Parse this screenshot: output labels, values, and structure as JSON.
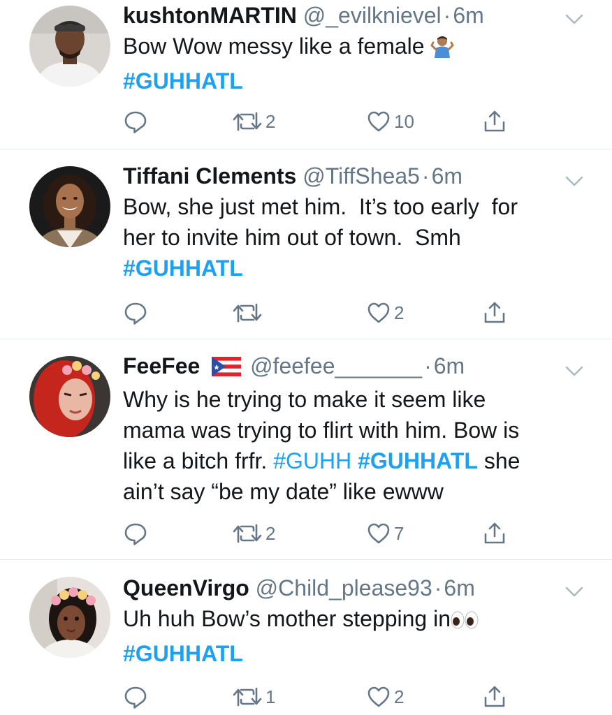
{
  "tweets": [
    {
      "name": "kushtonMARTIN",
      "handle": "@_evilknievel",
      "dot": "·",
      "time": "6m",
      "text_lines": [
        "Bow Wow messy like a female"
      ],
      "hashtag": "#GUHHATL",
      "retweets": "2",
      "likes": "10",
      "avatar_icon": "man-avatar",
      "emoji_icon": "person-shrugging-icon"
    },
    {
      "name": "Tiffani Clements",
      "handle": "@TiffShea5",
      "dot": "·",
      "time": "6m",
      "text_lines": [
        "Bow, she just met him.  It’s too early  for",
        "her to invite him out of town.  Smh"
      ],
      "hashtag": "#GUHHATL",
      "retweets": "",
      "likes": "2",
      "avatar_icon": "woman-avatar"
    },
    {
      "name": "FeeFee",
      "handle": "@feefee_______",
      "dot": "·",
      "time": "6m",
      "text_lines": [
        "Why is he trying to make it seem like",
        "mama was trying to flirt with him. Bow is",
        "like a bitch frfr."
      ],
      "inline_hashtag_1": "#GUHH",
      "inline_hashtag_2": "#GUHHATL",
      "text_after_line3": "she",
      "text_line4": "ain’t say “be my date” like ewww",
      "retweets": "2",
      "likes": "7",
      "avatar_icon": "red-hair-woman-avatar",
      "flag_icon": "puerto-rico-flag-icon"
    },
    {
      "name": "QueenVirgo",
      "handle": "@Child_please93",
      "dot": "·",
      "time": "6m",
      "text_lines": [
        "Uh huh Bow’s mother stepping in"
      ],
      "hashtag": "#GUHHATL",
      "retweets": "1",
      "likes": "2",
      "avatar_icon": "flower-crown-woman-avatar",
      "emoji_icon": "eyes-icon"
    }
  ],
  "colors": {
    "text": "#14171a",
    "secondary": "#657786",
    "link": "#1da1f2",
    "divider": "#e1e8ed"
  }
}
